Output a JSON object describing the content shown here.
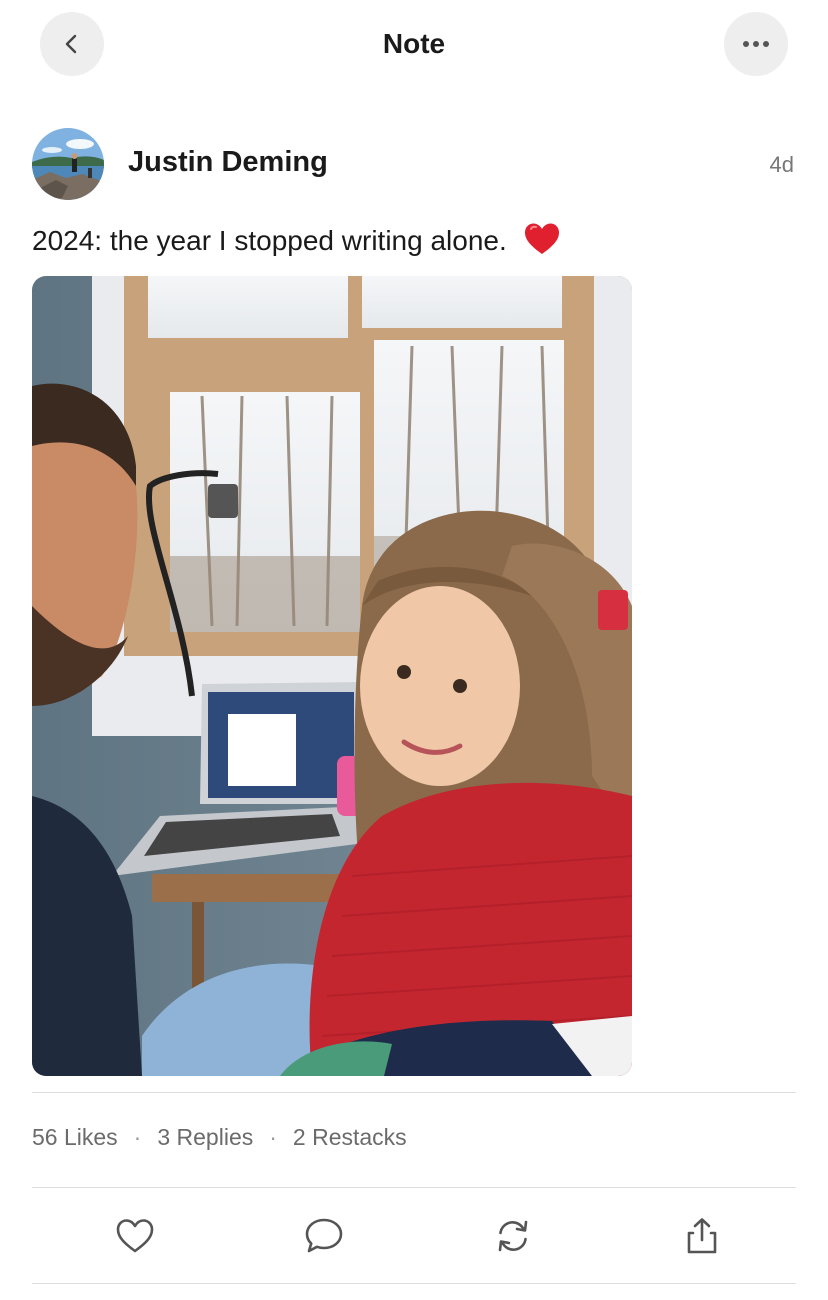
{
  "header": {
    "title": "Note",
    "back_icon": "chevron-left-icon",
    "more_icon": "ellipsis-icon"
  },
  "post": {
    "author": "Justin Deming",
    "timestamp": "4d",
    "text": "2024: the year I stopped writing alone.",
    "emoji_icon": "red-heart-emoji"
  },
  "stats": {
    "likes": "56 Likes",
    "replies": "3 Replies",
    "restacks": "2 Restacks",
    "separator": "·"
  },
  "actions": {
    "like_icon": "heart-icon",
    "reply_icon": "comment-bubble-icon",
    "restack_icon": "restack-arrows-icon",
    "share_icon": "share-upload-icon"
  },
  "colors": {
    "button_bg": "#eeeeee",
    "text_primary": "#1a1a1a",
    "text_secondary": "#6b6b6b",
    "heart_red": "#e0202f",
    "divider": "#dddddd"
  }
}
